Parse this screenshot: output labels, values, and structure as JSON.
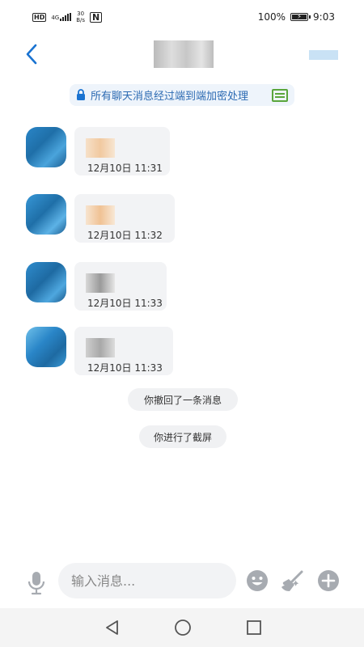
{
  "status_bar": {
    "hd": "HD",
    "network": "4G",
    "speed_value": "30",
    "speed_unit": "B/s",
    "nfc": "N",
    "battery_percent": "100%",
    "battery_level": 1.0,
    "time": "9:03"
  },
  "notice": {
    "text": "所有聊天消息经过端到端加密处理"
  },
  "messages": [
    {
      "time": "12月10日 11:31"
    },
    {
      "time": "12月10日 11:32"
    },
    {
      "time": "12月10日 11:33"
    },
    {
      "time": "12月10日 11:33"
    }
  ],
  "system_messages": [
    "你撤回了一条消息",
    "你进行了截屏"
  ],
  "input": {
    "placeholder": "输入消息..."
  },
  "icons": {
    "back": "chevron-left-icon",
    "lock": "lock-icon",
    "doc": "document-icon",
    "mic": "microphone-icon",
    "emoji": "smiley-icon",
    "broom": "broom-icon",
    "plus": "plus-icon",
    "nav_back": "triangle-back-icon",
    "nav_home": "circle-home-icon",
    "nav_recent": "square-recent-icon"
  },
  "colors": {
    "accent": "#1a73d1",
    "notice_text": "#2d6bb3",
    "icon_gray": "#a7abb1"
  }
}
